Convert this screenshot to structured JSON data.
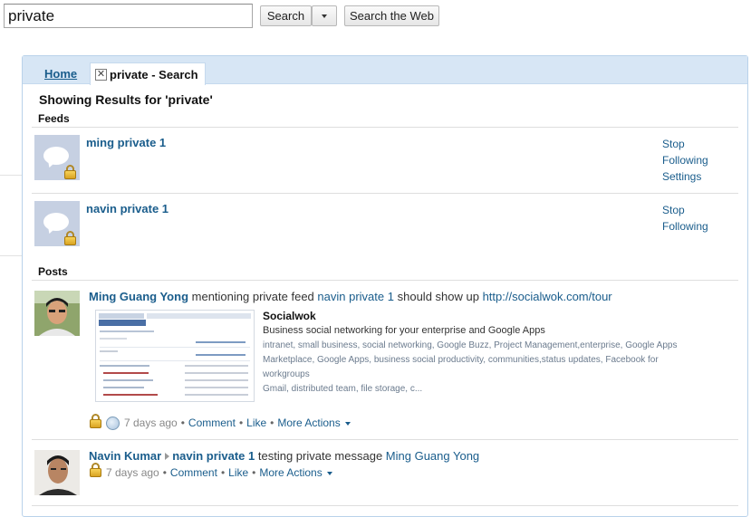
{
  "search": {
    "query": "private",
    "button_label": "Search",
    "web_button_label": "Search the Web"
  },
  "tabs": {
    "home_label": "Home",
    "active_label": "private - Search"
  },
  "results": {
    "heading": "Showing Results for 'private'",
    "feeds_label": "Feeds",
    "posts_label": "Posts"
  },
  "feeds": [
    {
      "name": "ming private 1",
      "actions": [
        "Stop",
        "Following",
        "Settings"
      ]
    },
    {
      "name": "navin private 1",
      "actions": [
        "Stop",
        "Following"
      ]
    }
  ],
  "posts": [
    {
      "author": "Ming Guang Yong",
      "text_before": "mentioning private feed",
      "feed_link": "navin private 1",
      "text_after": "should show up",
      "url": "http://socialwok.com/tour",
      "link_preview": {
        "title": "Socialwok",
        "description": "Business social networking for your enterprise and Google Apps",
        "tags_line1": "intranet, small business, social networking, Google Buzz, Project Management,enterprise, Google Apps",
        "tags_line2": "Marketplace, Google Apps, business social productivity, communities,status updates, Facebook for workgroups",
        "tags_line3": "Gmail, distributed team, file storage, c..."
      },
      "time": "7 days ago",
      "actions": {
        "comment": "Comment",
        "like": "Like",
        "more": "More Actions"
      }
    },
    {
      "author": "Navin Kumar",
      "feed_link": "navin private 1",
      "text": "testing private message",
      "mention": "Ming Guang Yong",
      "time": "7 days ago",
      "actions": {
        "comment": "Comment",
        "like": "Like",
        "more": "More Actions"
      }
    }
  ],
  "separator": "•",
  "colors": {
    "link": "#1a5d8c",
    "tab_bar": "#d7e6f5",
    "panel_border": "#b9d2ea"
  }
}
